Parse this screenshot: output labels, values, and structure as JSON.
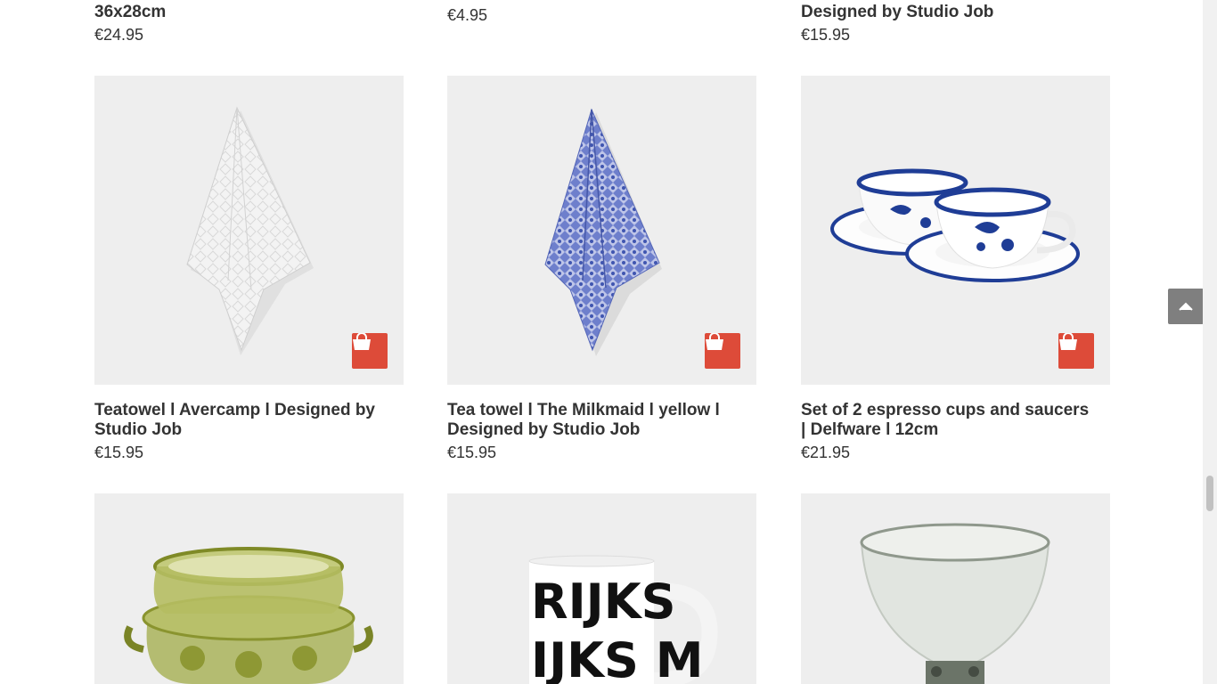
{
  "partial_row": [
    {
      "title": "36x28cm",
      "price": "€24.95"
    },
    {
      "title": "",
      "price": "€4.95"
    },
    {
      "title": "Designed by Studio Job",
      "price": "€15.95"
    }
  ],
  "products": [
    {
      "title": "Teatowel l Avercamp l Designed by Studio Job",
      "price": "€15.95",
      "image": "white tea towel"
    },
    {
      "title": "Tea towel l The Milkmaid l yellow l Designed by Studio Job",
      "price": "€15.95",
      "image": "blue patterned tea towel"
    },
    {
      "title": "Set of 2 espresso cups and saucers | Delfware l 12cm",
      "price": "€21.95",
      "image": "Delft blue espresso cups"
    },
    {
      "title": "",
      "price": "",
      "image": "green glass bowl"
    },
    {
      "title": "",
      "price": "",
      "image": "Rijksmuseum mug"
    },
    {
      "title": "",
      "price": "",
      "image": "clear glass roemer"
    }
  ],
  "mug_text": {
    "line1": "RIJKS",
    "line2": "IJKS M"
  },
  "icons": {
    "cart": "shopping-bag-icon",
    "back_to_top": "chevron-up-icon"
  },
  "colors": {
    "tile_bg": "#eeeeee",
    "cart_button": "#dd4b39",
    "back_to_top": "#7f7f7f",
    "delft_blue": "#1f3d96"
  }
}
